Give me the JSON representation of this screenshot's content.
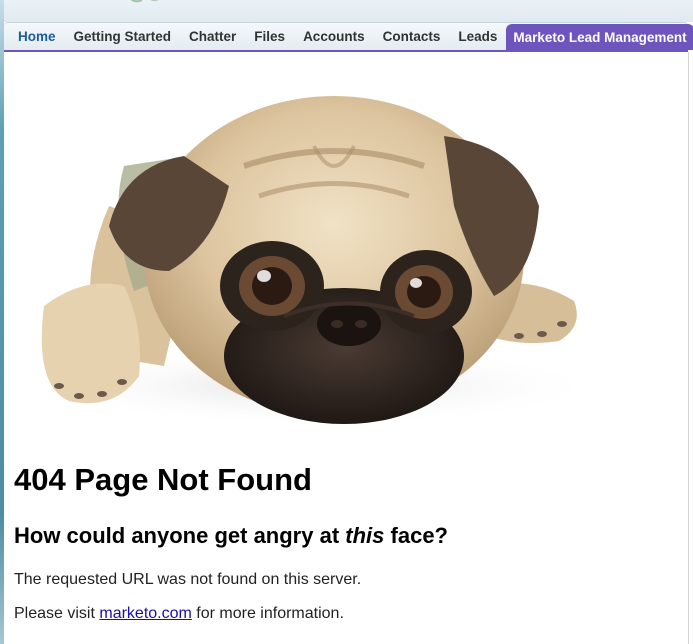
{
  "tabs": [
    {
      "label": "Home"
    },
    {
      "label": "Getting Started"
    },
    {
      "label": "Chatter"
    },
    {
      "label": "Files"
    },
    {
      "label": "Accounts"
    },
    {
      "label": "Contacts"
    },
    {
      "label": "Leads"
    },
    {
      "label": "Marketo Lead Management"
    }
  ],
  "active_tab": "Marketo Lead Management",
  "colors": {
    "active_tab": "#6e54bd",
    "home_tab": "#1b5c9e",
    "link": "#1a0dab"
  },
  "error": {
    "title": "404 Page Not Found",
    "subtitle_before": "How could anyone get angry at ",
    "subtitle_emphasis": "this",
    "subtitle_after": " face?",
    "message": "The requested URL was not found on this server.",
    "visit_before": "Please visit ",
    "visit_link": "marketo.com",
    "visit_after": " for more information."
  },
  "image": {
    "icon": "pug-dog-image"
  }
}
